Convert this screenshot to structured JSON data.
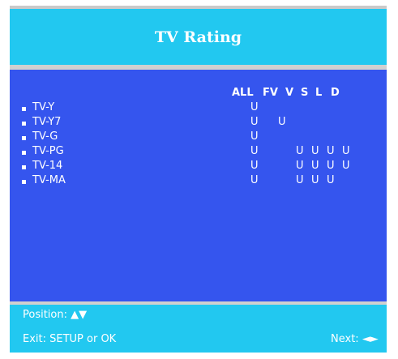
{
  "header": {
    "title": "TV Rating"
  },
  "columns": [
    "ALL",
    "FV",
    "V",
    "S",
    "L",
    "D"
  ],
  "rows": [
    {
      "label": "TV-Y",
      "cells": [
        "U",
        "",
        "",
        "",
        "",
        ""
      ]
    },
    {
      "label": "TV-Y7",
      "cells": [
        "U",
        "U",
        "",
        "",
        "",
        ""
      ]
    },
    {
      "label": "TV-G",
      "cells": [
        "U",
        "",
        "",
        "",
        "",
        ""
      ]
    },
    {
      "label": "TV-PG",
      "cells": [
        "U",
        "",
        "U",
        "U",
        "U",
        "U"
      ]
    },
    {
      "label": "TV-14",
      "cells": [
        "U",
        "",
        "U",
        "U",
        "U",
        "U"
      ]
    },
    {
      "label": "TV-MA",
      "cells": [
        "U",
        "",
        "U",
        "U",
        "U",
        ""
      ]
    }
  ],
  "footer": {
    "position_label": "Position:",
    "position_arrows": "▲▼",
    "exit_label": "Exit: SETUP or OK",
    "next_label": "Next:",
    "next_arrows": "◄►"
  },
  "colors": {
    "header_bg": "#22c8f0",
    "panel_bg": "#3555ee",
    "text": "#ffffff"
  }
}
